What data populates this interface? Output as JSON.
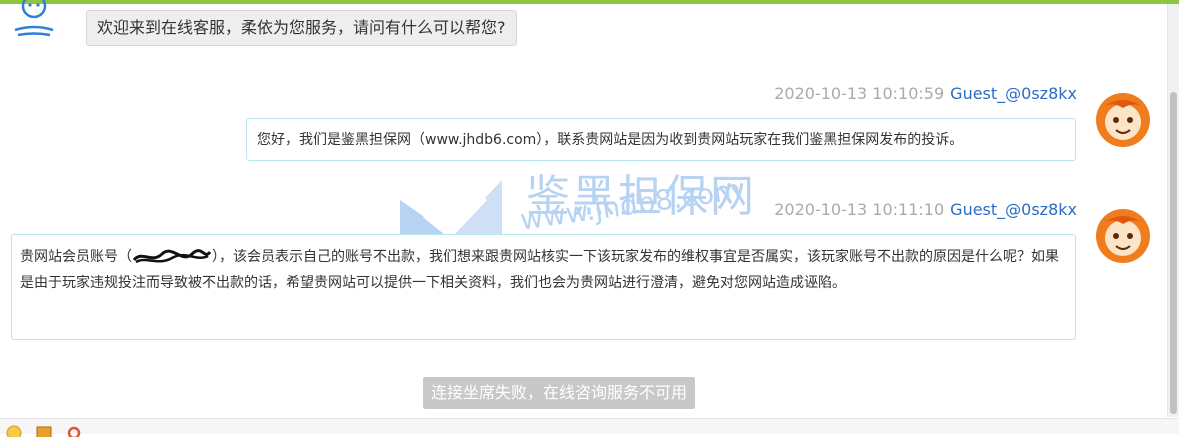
{
  "chat": {
    "agent_message": "欢迎来到在线客服，柔依为您服务，请问有什么可以帮您?",
    "messages": [
      {
        "time": "2020-10-13 10:10:59",
        "sender": "Guest_@0sz8kx",
        "text": "您好，我们是鉴黑担保网（www.jhdb6.com），联系贵网站是因为收到贵网站玩家在我们鉴黑担保网发布的投诉。"
      },
      {
        "time": "2020-10-13 10:11:10",
        "sender": "Guest_@0sz8kx",
        "text_before": "贵网站会员账号（",
        "text_after": "），该会员表示自己的账号不出款，我们想来跟贵网站核实一下该玩家发布的维权事宜是否属实，该玩家账号不出款的原因是什么呢？如果是由于玩家违规投注而导致被不出款的话，希望贵网站可以提供一下相关资料，我们也会为贵网站进行澄清，避免对您网站造成诬陷。"
      }
    ],
    "status_toast": "连接坐席失败，在线咨询服务不可用"
  },
  "watermark": {
    "title": "鉴黑担保网",
    "url": "www.jhdb8.com"
  },
  "toolbar": {
    "icons": [
      "emoji-icon",
      "image-icon",
      "settings-icon"
    ]
  },
  "colors": {
    "accent_bar": "#8dc63f",
    "sender_name": "#2b6cc4",
    "bubble_border": "#b9e4ec",
    "toast_bg": "#c8c8c8"
  }
}
